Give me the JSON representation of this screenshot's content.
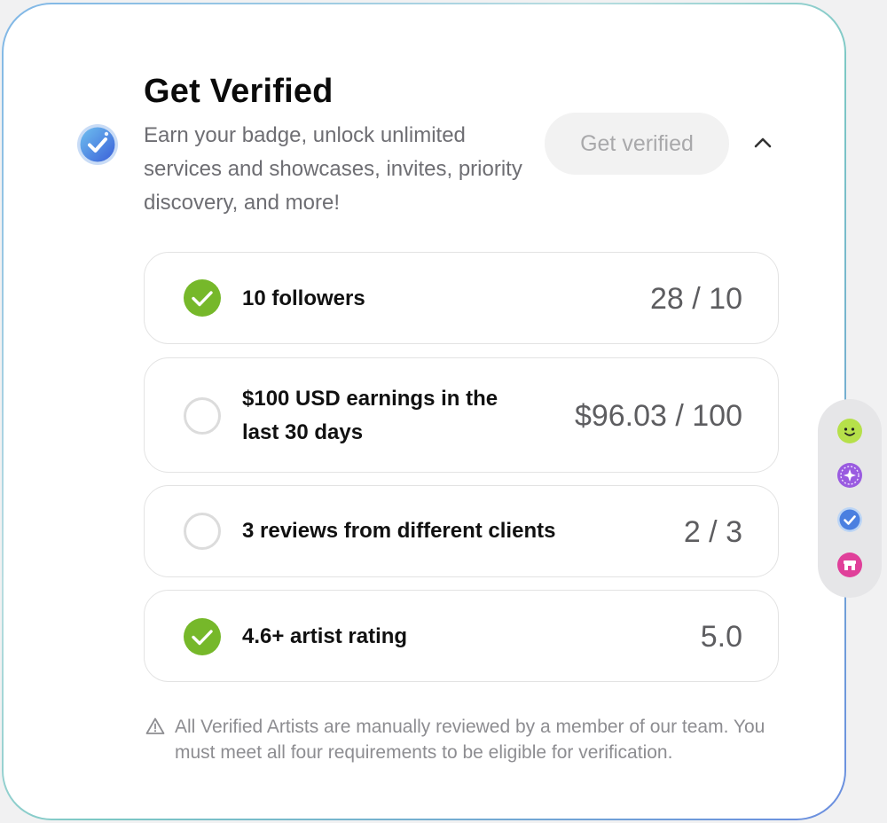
{
  "header": {
    "title": "Get Verified",
    "description": "Earn your badge, unlock unlimited services and showcases, invites, priority discovery, and more!",
    "button_label": "Get verified",
    "badge_icon": "verified-badge-icon",
    "collapse_icon": "chevron-up-icon"
  },
  "requirements": [
    {
      "label": "10 followers",
      "value": "28 / 10",
      "met": true
    },
    {
      "label": "$100 USD earnings in the last 30 days",
      "value": "$96.03 / 100",
      "met": false
    },
    {
      "label": "3 reviews from different clients",
      "value": "2 / 3",
      "met": false
    },
    {
      "label": "4.6+ artist rating",
      "value": "5.0",
      "met": true
    }
  ],
  "note": {
    "icon": "warning-icon",
    "text": "All Verified Artists are manually reviewed by a member of our team. You must meet all four requirements to be eligible for verification."
  },
  "side_nav": {
    "icons": [
      "smiley-icon",
      "sparkle-icon",
      "verified-icon",
      "store-icon"
    ]
  },
  "colors": {
    "check_green": "#76b82a",
    "circle_empty": "#dcdcdc",
    "badge_blue": "#4a7fe0"
  }
}
